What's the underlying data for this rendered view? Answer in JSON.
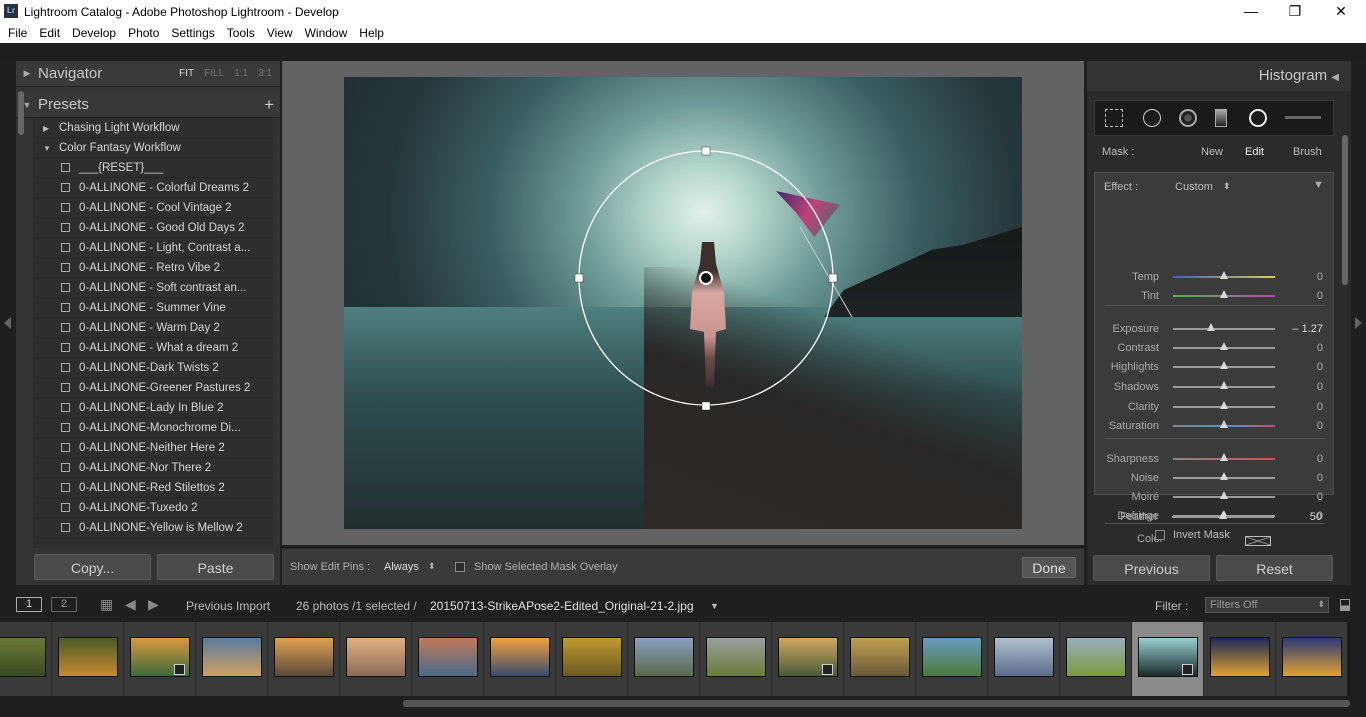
{
  "window": {
    "title": "Lightroom Catalog - Adobe Photoshop Lightroom - Develop",
    "app_badge": "Lr",
    "minimize": "—",
    "restore": "❐",
    "close": "✕"
  },
  "menu": [
    "File",
    "Edit",
    "Develop",
    "Photo",
    "Settings",
    "Tools",
    "View",
    "Window",
    "Help"
  ],
  "navigator": {
    "title": "Navigator",
    "opts": [
      "FIT",
      "FILL",
      "1:1",
      "3:1"
    ],
    "active": "FIT"
  },
  "presets": {
    "title": "Presets",
    "add": "+",
    "folders": [
      "Chasing Light Workflow",
      "Color Fantasy Workflow"
    ],
    "items": [
      "___{RESET}___",
      "0-ALLINONE - Colorful Dreams 2",
      "0-ALLINONE - Cool Vintage 2",
      "0-ALLINONE - Good Old Days 2",
      "0-ALLINONE - Light, Contrast a...",
      "0-ALLINONE - Retro Vibe 2",
      "0-ALLINONE - Soft contrast an...",
      "0-ALLINONE - Summer Vine",
      "0-ALLINONE - Warm Day 2",
      "0-ALLINONE - What a dream 2",
      "0-ALLINONE-Dark Twists 2",
      "0-ALLINONE-Greener Pastures 2",
      "0-ALLINONE-Lady In Blue 2",
      "0-ALLINONE-Monochrome Di...",
      "0-ALLINONE-Neither Here 2",
      "0-ALLINONE-Nor There 2",
      "0-ALLINONE-Red Stilettos 2",
      "0-ALLINONE-Tuxedo 2",
      "0-ALLINONE-Yellow is Mellow 2"
    ]
  },
  "left_buttons": {
    "copy": "Copy...",
    "paste": "Paste"
  },
  "toolbar": {
    "pins_label": "Show Edit Pins :",
    "pins_value": "Always",
    "overlay_label": "Show Selected Mask Overlay",
    "done": "Done"
  },
  "right": {
    "histogram": "Histogram",
    "mask": {
      "label": "Mask :",
      "new": "New",
      "edit": "Edit",
      "brush": "Brush"
    },
    "effect": {
      "label": "Effect :",
      "value": "Custom"
    },
    "sliders": [
      {
        "name": "Temp",
        "value": "0",
        "pos": 0.5,
        "color": "temp"
      },
      {
        "name": "Tint",
        "value": "0",
        "pos": 0.5,
        "color": "tint"
      },
      {
        "name": "Exposure",
        "value": "– 1.27",
        "pos": 0.37,
        "color": ""
      },
      {
        "name": "Contrast",
        "value": "0",
        "pos": 0.5,
        "color": ""
      },
      {
        "name": "Highlights",
        "value": "0",
        "pos": 0.5,
        "color": ""
      },
      {
        "name": "Shadows",
        "value": "0",
        "pos": 0.5,
        "color": ""
      },
      {
        "name": "Clarity",
        "value": "0",
        "pos": 0.5,
        "color": ""
      },
      {
        "name": "Saturation",
        "value": "0",
        "pos": 0.5,
        "color": "sat"
      },
      {
        "name": "Sharpness",
        "value": "0",
        "pos": 0.5,
        "color": "sharp"
      },
      {
        "name": "Noise",
        "value": "0",
        "pos": 0.5,
        "color": ""
      },
      {
        "name": "Moiré",
        "value": "0",
        "pos": 0.5,
        "color": ""
      },
      {
        "name": "Defringe",
        "value": "0",
        "pos": 0.5,
        "color": ""
      }
    ],
    "color_label": "Color",
    "feather": {
      "name": "Feather",
      "value": "50",
      "pos": 0.5
    },
    "invert": "Invert Mask",
    "previous": "Previous",
    "reset": "Reset"
  },
  "filmbar": {
    "page1": "1",
    "page2": "2",
    "source": "Previous Import",
    "count": "26 photos /1 selected /",
    "filename": "20150713-StrikeAPose2-Edited_Original-21-2.jpg",
    "filter_label": "Filter :",
    "filter_value": "Filters Off"
  },
  "filmstrip": {
    "selected_index": 16,
    "thumbs": [
      {
        "c1": "#6a7a3a",
        "c2": "#3a4a22",
        "badge": false
      },
      {
        "c1": "#4a5a2a",
        "c2": "#c98a30",
        "badge": false
      },
      {
        "c1": "#d89a40",
        "c2": "#3d6a3a",
        "badge": true
      },
      {
        "c1": "#5a7aa0",
        "c2": "#d0a060",
        "badge": false
      },
      {
        "c1": "#e0a050",
        "c2": "#5a4a3a",
        "badge": false
      },
      {
        "c1": "#e0b080",
        "c2": "#8a6a5a",
        "badge": false
      },
      {
        "c1": "#c07a5a",
        "c2": "#4a6a8a",
        "badge": false
      },
      {
        "c1": "#f0a040",
        "c2": "#3a4a6a",
        "badge": false
      },
      {
        "c1": "#c09a30",
        "c2": "#6a5a22",
        "badge": false
      },
      {
        "c1": "#8aa0c0",
        "c2": "#5a6a4a",
        "badge": false
      },
      {
        "c1": "#9aa0a0",
        "c2": "#6a7a3a",
        "badge": false
      },
      {
        "c1": "#d0a860",
        "c2": "#4a5a3a",
        "badge": true
      },
      {
        "c1": "#c0a050",
        "c2": "#6a5a3a",
        "badge": false
      },
      {
        "c1": "#6a9ac0",
        "c2": "#4a7a3a",
        "badge": false
      },
      {
        "c1": "#b0c0d0",
        "c2": "#5a6a8a",
        "badge": false
      },
      {
        "c1": "#9ab0c0",
        "c2": "#7a9a3a",
        "badge": false
      },
      {
        "c1": "#9ad0d0",
        "c2": "#1a2a2a",
        "badge": true
      },
      {
        "c1": "#1a2a5a",
        "c2": "#e0a030",
        "badge": false
      },
      {
        "c1": "#2a3a7a",
        "c2": "#e0a030",
        "badge": false
      }
    ]
  }
}
